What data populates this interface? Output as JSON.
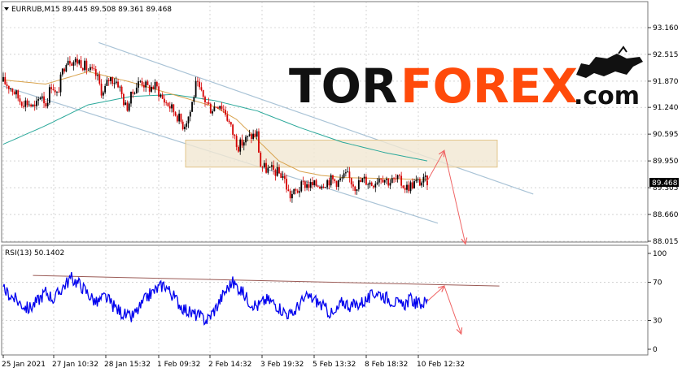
{
  "header": {
    "symbol_info": "EURRUB,M15  89.445 89.508 89.361 89.468",
    "rsi_info": "RSI(13) 50.1402"
  },
  "brand": {
    "part1": "TOR",
    "part2": "FOREX",
    "part3": ".com"
  },
  "colors": {
    "candle_up": "#000000",
    "candle_down": "#d40000",
    "ma_fast": "#d8a24c",
    "ma_slow": "#2aa89a",
    "channel": "#a9c3d6",
    "zone_fill": "#f1e7d2",
    "zone_border": "#e2c58a",
    "arrow": "#ef6464",
    "rsi_line": "#0000ee",
    "rsi_trend": "#9a5a55",
    "grid": "#b8b8b8",
    "price_tag_bg": "#000000",
    "price_tag_text": "#ffffff"
  },
  "chart_data": [
    {
      "type": "candlestick",
      "title": "EURRUB,M15",
      "ohlc_last": {
        "open": 89.445,
        "high": 89.508,
        "low": 89.361,
        "close": 89.468
      },
      "y_ticks": [
        "93.160",
        "92.515",
        "91.870",
        "91.240",
        "90.595",
        "89.950",
        "89.305",
        "88.660",
        "88.015"
      ],
      "y_tick_values": [
        93.16,
        92.515,
        91.87,
        91.24,
        90.595,
        89.95,
        89.305,
        88.66,
        88.015
      ],
      "x_ticks": [
        "25 Jan 2021",
        "27 Jan 10:32",
        "28 Jan 15:32",
        "1 Feb 09:32",
        "2 Feb 14:32",
        "3 Feb 19:32",
        "5 Feb 13:32",
        "8 Feb 18:32",
        "10 Feb 12:32"
      ],
      "current_price_label": "89.468",
      "price_path": [
        [
          0,
          91.86
        ],
        [
          0.02,
          91.7
        ],
        [
          0.04,
          91.4
        ],
        [
          0.06,
          91.35
        ],
        [
          0.075,
          91.2
        ],
        [
          0.09,
          91.6
        ],
        [
          0.1,
          91.3
        ],
        [
          0.115,
          91.85
        ],
        [
          0.125,
          91.45
        ],
        [
          0.14,
          92.1
        ],
        [
          0.15,
          92.45
        ],
        [
          0.165,
          92.35
        ],
        [
          0.18,
          92.35
        ],
        [
          0.2,
          92.15
        ],
        [
          0.22,
          92.0
        ],
        [
          0.235,
          91.55
        ],
        [
          0.25,
          91.95
        ],
        [
          0.27,
          91.85
        ],
        [
          0.29,
          91.2
        ],
        [
          0.31,
          91.7
        ],
        [
          0.325,
          91.9
        ],
        [
          0.34,
          91.7
        ],
        [
          0.36,
          91.75
        ],
        [
          0.375,
          91.45
        ],
        [
          0.39,
          91.3
        ],
        [
          0.41,
          91.05
        ],
        [
          0.425,
          90.8
        ],
        [
          0.44,
          91.1
        ],
        [
          0.455,
          91.8
        ],
        [
          0.47,
          91.5
        ],
        [
          0.49,
          91.2
        ],
        [
          0.51,
          91.35
        ],
        [
          0.525,
          91.1
        ],
        [
          0.54,
          90.65
        ],
        [
          0.555,
          90.3
        ],
        [
          0.57,
          90.45
        ],
        [
          0.585,
          90.55
        ],
        [
          0.6,
          90.6
        ],
        [
          0.605,
          89.85
        ],
        [
          0.62,
          89.75
        ],
        [
          0.64,
          89.7
        ],
        [
          0.66,
          89.6
        ],
        [
          0.675,
          89.1
        ],
        [
          0.69,
          89.2
        ],
        [
          0.71,
          89.4
        ],
        [
          0.73,
          89.35
        ],
        [
          0.75,
          89.4
        ],
        [
          0.77,
          89.5
        ],
        [
          0.79,
          89.45
        ],
        [
          0.81,
          89.6
        ],
        [
          0.83,
          89.35
        ],
        [
          0.85,
          89.5
        ],
        [
          0.87,
          89.4
        ],
        [
          0.89,
          89.6
        ],
        [
          0.91,
          89.45
        ],
        [
          0.93,
          89.5
        ],
        [
          0.95,
          89.3
        ],
        [
          0.97,
          89.42
        ],
        [
          1.0,
          89.468
        ]
      ],
      "ma_fast_path": [
        [
          0,
          91.9
        ],
        [
          0.1,
          91.8
        ],
        [
          0.2,
          92.1
        ],
        [
          0.3,
          91.85
        ],
        [
          0.4,
          91.55
        ],
        [
          0.5,
          91.25
        ],
        [
          0.55,
          90.95
        ],
        [
          0.6,
          90.45
        ],
        [
          0.65,
          89.95
        ],
        [
          0.7,
          89.7
        ],
        [
          0.75,
          89.6
        ],
        [
          0.8,
          89.55
        ],
        [
          1.0,
          89.5
        ]
      ],
      "ma_slow_path": [
        [
          0,
          90.35
        ],
        [
          0.1,
          90.8
        ],
        [
          0.2,
          91.3
        ],
        [
          0.3,
          91.5
        ],
        [
          0.4,
          91.55
        ],
        [
          0.5,
          91.4
        ],
        [
          0.6,
          91.15
        ],
        [
          0.7,
          90.75
        ],
        [
          0.8,
          90.4
        ],
        [
          0.9,
          90.15
        ],
        [
          1.0,
          89.95
        ]
      ],
      "channel_upper": [
        [
          0.225,
          92.8
        ],
        [
          1.25,
          89.15
        ]
      ],
      "channel_lower": [
        [
          0.0,
          91.75
        ],
        [
          1.025,
          88.45
        ]
      ],
      "zone": {
        "from": 0.43,
        "to": 1.165,
        "price_top": 90.45,
        "price_bottom": 89.8
      },
      "arrow_up": {
        "from": [
          1.0,
          89.468
        ],
        "to": [
          1.04,
          90.2
        ]
      },
      "arrow_down": {
        "from": [
          1.04,
          90.2
        ],
        "to": [
          1.09,
          87.95
        ]
      }
    },
    {
      "type": "line",
      "title": "RSI(13) 50.1402",
      "y_ticks": [
        "100",
        "70",
        "30",
        "0"
      ],
      "y_tick_values": [
        100,
        70,
        30,
        0
      ],
      "current_value": 50.1402,
      "rsi_path": [
        [
          0,
          62
        ],
        [
          0.02,
          55
        ],
        [
          0.04,
          48
        ],
        [
          0.06,
          42
        ],
        [
          0.08,
          50
        ],
        [
          0.1,
          60
        ],
        [
          0.12,
          52
        ],
        [
          0.14,
          65
        ],
        [
          0.16,
          74
        ],
        [
          0.18,
          68
        ],
        [
          0.2,
          58
        ],
        [
          0.22,
          48
        ],
        [
          0.24,
          55
        ],
        [
          0.26,
          45
        ],
        [
          0.28,
          38
        ],
        [
          0.3,
          32
        ],
        [
          0.32,
          42
        ],
        [
          0.34,
          55
        ],
        [
          0.36,
          62
        ],
        [
          0.38,
          68
        ],
        [
          0.4,
          56
        ],
        [
          0.42,
          45
        ],
        [
          0.44,
          38
        ],
        [
          0.46,
          35
        ],
        [
          0.48,
          30
        ],
        [
          0.5,
          42
        ],
        [
          0.52,
          58
        ],
        [
          0.54,
          70
        ],
        [
          0.56,
          62
        ],
        [
          0.58,
          50
        ],
        [
          0.6,
          45
        ],
        [
          0.62,
          52
        ],
        [
          0.64,
          48
        ],
        [
          0.66,
          40
        ],
        [
          0.68,
          35
        ],
        [
          0.7,
          48
        ],
        [
          0.72,
          55
        ],
        [
          0.74,
          50
        ],
        [
          0.76,
          42
        ],
        [
          0.78,
          35
        ],
        [
          0.8,
          50
        ],
        [
          0.82,
          45
        ],
        [
          0.84,
          48
        ],
        [
          0.86,
          52
        ],
        [
          0.88,
          60
        ],
        [
          0.9,
          55
        ],
        [
          0.92,
          50
        ],
        [
          0.94,
          45
        ],
        [
          0.96,
          52
        ],
        [
          0.98,
          47
        ],
        [
          1.0,
          50.14
        ]
      ],
      "trend_line": [
        [
          0.07,
          77
        ],
        [
          1.17,
          66
        ]
      ],
      "arrow_up": {
        "from": [
          1.0,
          50.14
        ],
        "to": [
          1.04,
          66
        ]
      },
      "arrow_down": {
        "from": [
          1.04,
          66
        ],
        "to": [
          1.08,
          16
        ]
      }
    }
  ]
}
